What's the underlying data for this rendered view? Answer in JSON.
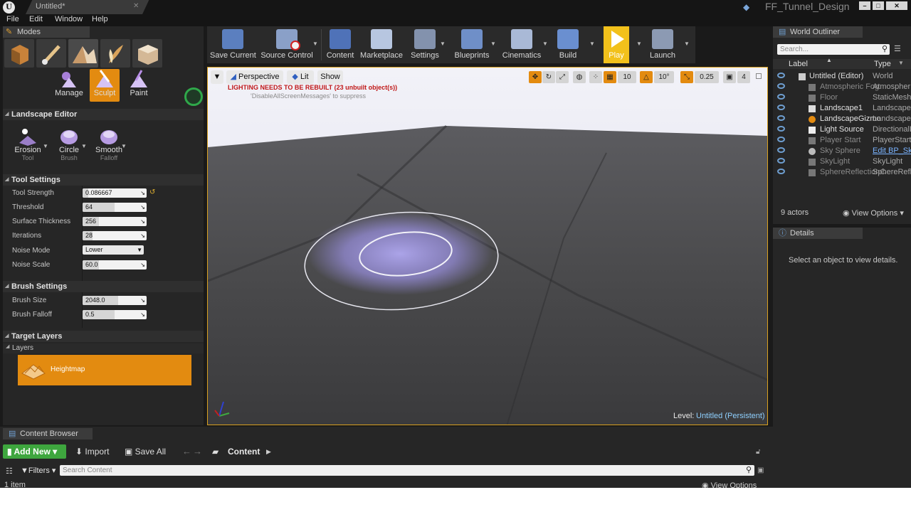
{
  "title_bar": {
    "doc_tab": "Untitled*",
    "project_name": "FF_Tunnel_Design"
  },
  "menu": [
    "File",
    "Edit",
    "Window",
    "Help"
  ],
  "modes_panel": {
    "tab_label": "Modes",
    "landscape_tools": [
      {
        "label": "Manage"
      },
      {
        "label": "Sculpt",
        "active": true
      },
      {
        "label": "Paint"
      }
    ],
    "landscape_editor_header": "Landscape Editor",
    "tool_row": [
      {
        "label": "Erosion",
        "sub": "Tool"
      },
      {
        "label": "Circle",
        "sub": "Brush"
      },
      {
        "label": "Smooth",
        "sub": "Falloff"
      }
    ],
    "tool_settings_header": "Tool Settings",
    "tool_settings": [
      {
        "label": "Tool Strength",
        "value": "0.086667",
        "fill": 0.086667
      },
      {
        "label": "Threshold",
        "value": "64",
        "fill": 0.5
      },
      {
        "label": "Surface Thickness",
        "value": "256",
        "fill": 0.25
      },
      {
        "label": "Iterations",
        "value": "28",
        "fill": 0.15
      },
      {
        "label": "Noise Mode",
        "value": "Lower"
      },
      {
        "label": "Noise Scale",
        "value": "60.0",
        "fill": 0.25
      }
    ],
    "brush_settings_header": "Brush Settings",
    "brush_settings": [
      {
        "label": "Brush Size",
        "value": "2048.0",
        "fill": 0.55
      },
      {
        "label": "Brush Falloff",
        "value": "0.5",
        "fill": 0.5
      }
    ],
    "target_layers_header": "Target Layers",
    "layers_label": "Layers",
    "layer_item": "Heightmap"
  },
  "toolbar": [
    {
      "label": "Save Current"
    },
    {
      "label": "Source Control"
    },
    {
      "label": "Content"
    },
    {
      "label": "Marketplace"
    },
    {
      "label": "Settings"
    },
    {
      "label": "Blueprints"
    },
    {
      "label": "Cinematics"
    },
    {
      "label": "Build"
    },
    {
      "label": "Play"
    },
    {
      "label": "Launch"
    }
  ],
  "viewport": {
    "perspective": "Perspective",
    "lit": "Lit",
    "show": "Show",
    "warning": "LIGHTING NEEDS TO BE REBUILT (23 unbuilt object(s))",
    "suppress": "'DisableAllScreenMessages' to suppress",
    "grid_snap": "10",
    "rot_snap": "10°",
    "scale_snap": "0.25",
    "cam_speed": "4",
    "level_label": "Level:",
    "level_name": "Untitled (Persistent)"
  },
  "outliner": {
    "tab_label": "World Outliner",
    "search_placeholder": "Search...",
    "col_label": "Label",
    "col_type": "Type",
    "rows": [
      {
        "name": "Untitled (Editor)",
        "type": "World"
      },
      {
        "name": "Atmospheric Fog",
        "type": "AtmosphericFog"
      },
      {
        "name": "Floor",
        "type": "StaticMeshActor"
      },
      {
        "name": "Landscape1",
        "type": "Landscape"
      },
      {
        "name": "LandscapeGizmo",
        "type": "Landscape"
      },
      {
        "name": "Light Source",
        "type": "DirectionalLight"
      },
      {
        "name": "Player Start",
        "type": "PlayerStart"
      },
      {
        "name": "Sky Sphere",
        "type": "Edit BP_Sky_Sphere"
      },
      {
        "name": "SkyLight",
        "type": "SkyLight"
      },
      {
        "name": "SphereReflectionCapture",
        "type": "SphereReflectionCapture"
      }
    ],
    "actor_count": "9 actors",
    "view_options": "View Options"
  },
  "details": {
    "tab_label": "Details",
    "empty_msg": "Select an object to view details."
  },
  "content_browser": {
    "tab_label": "Content Browser",
    "add_new": "Add New",
    "import": "Import",
    "save_all": "Save All",
    "path": "Content",
    "filters": "Filters",
    "search_placeholder": "Search Content",
    "item_count": "1 item",
    "view_options": "View Options"
  },
  "colors": {
    "accent_orange": "#e38b10",
    "play_yellow": "#f2c11b",
    "link_blue": "#7ab3ff",
    "warning_red": "#c01818"
  }
}
